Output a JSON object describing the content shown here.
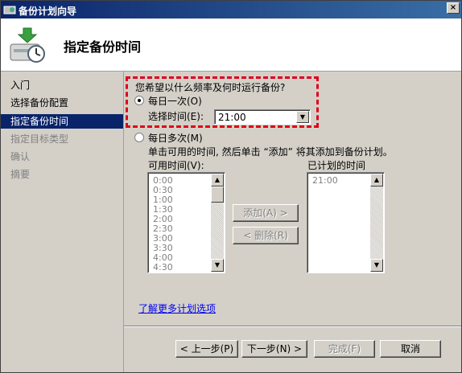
{
  "window": {
    "title": "备份计划向导",
    "close_glyph": "×"
  },
  "header": {
    "title": "指定备份时间"
  },
  "sidebar": {
    "items": [
      {
        "label": "入门"
      },
      {
        "label": "选择备份配置"
      },
      {
        "label": "指定备份时间"
      },
      {
        "label": "指定目标类型"
      },
      {
        "label": "确认"
      },
      {
        "label": "摘要"
      }
    ]
  },
  "content": {
    "question": "您希望以什么频率及何时运行备份?",
    "once_daily_label": "每日一次(O)",
    "select_time_label": "选择时间(E):",
    "select_time_value": "21:00",
    "multi_daily_label": "每日多次(M)",
    "instruction": "单击可用的时间, 然后单击 “添加” 将其添加到备份计划。",
    "available_label": "可用时间(V):",
    "scheduled_label": "已计划的时间",
    "available_times": [
      "0:00",
      "0:30",
      "1:00",
      "1:30",
      "2:00",
      "2:30",
      "3:00",
      "3:30",
      "4:00",
      "4:30"
    ],
    "scheduled_times": [
      "21:00"
    ],
    "add_button": "添加(A) >",
    "remove_button": "< 删除(R)",
    "more_options_link": "了解更多计划选项"
  },
  "footer": {
    "back_button": "< 上一步(P)",
    "next_button": "下一步(N) >",
    "finish_button": "完成(F)",
    "cancel_button": "取消"
  },
  "selection": {
    "once_daily_selected": true,
    "active_sidebar_item": "指定备份时间"
  },
  "colors": {
    "accent": "#0a246a",
    "highlight_border": "#e0001a",
    "link": "#0000ee"
  }
}
